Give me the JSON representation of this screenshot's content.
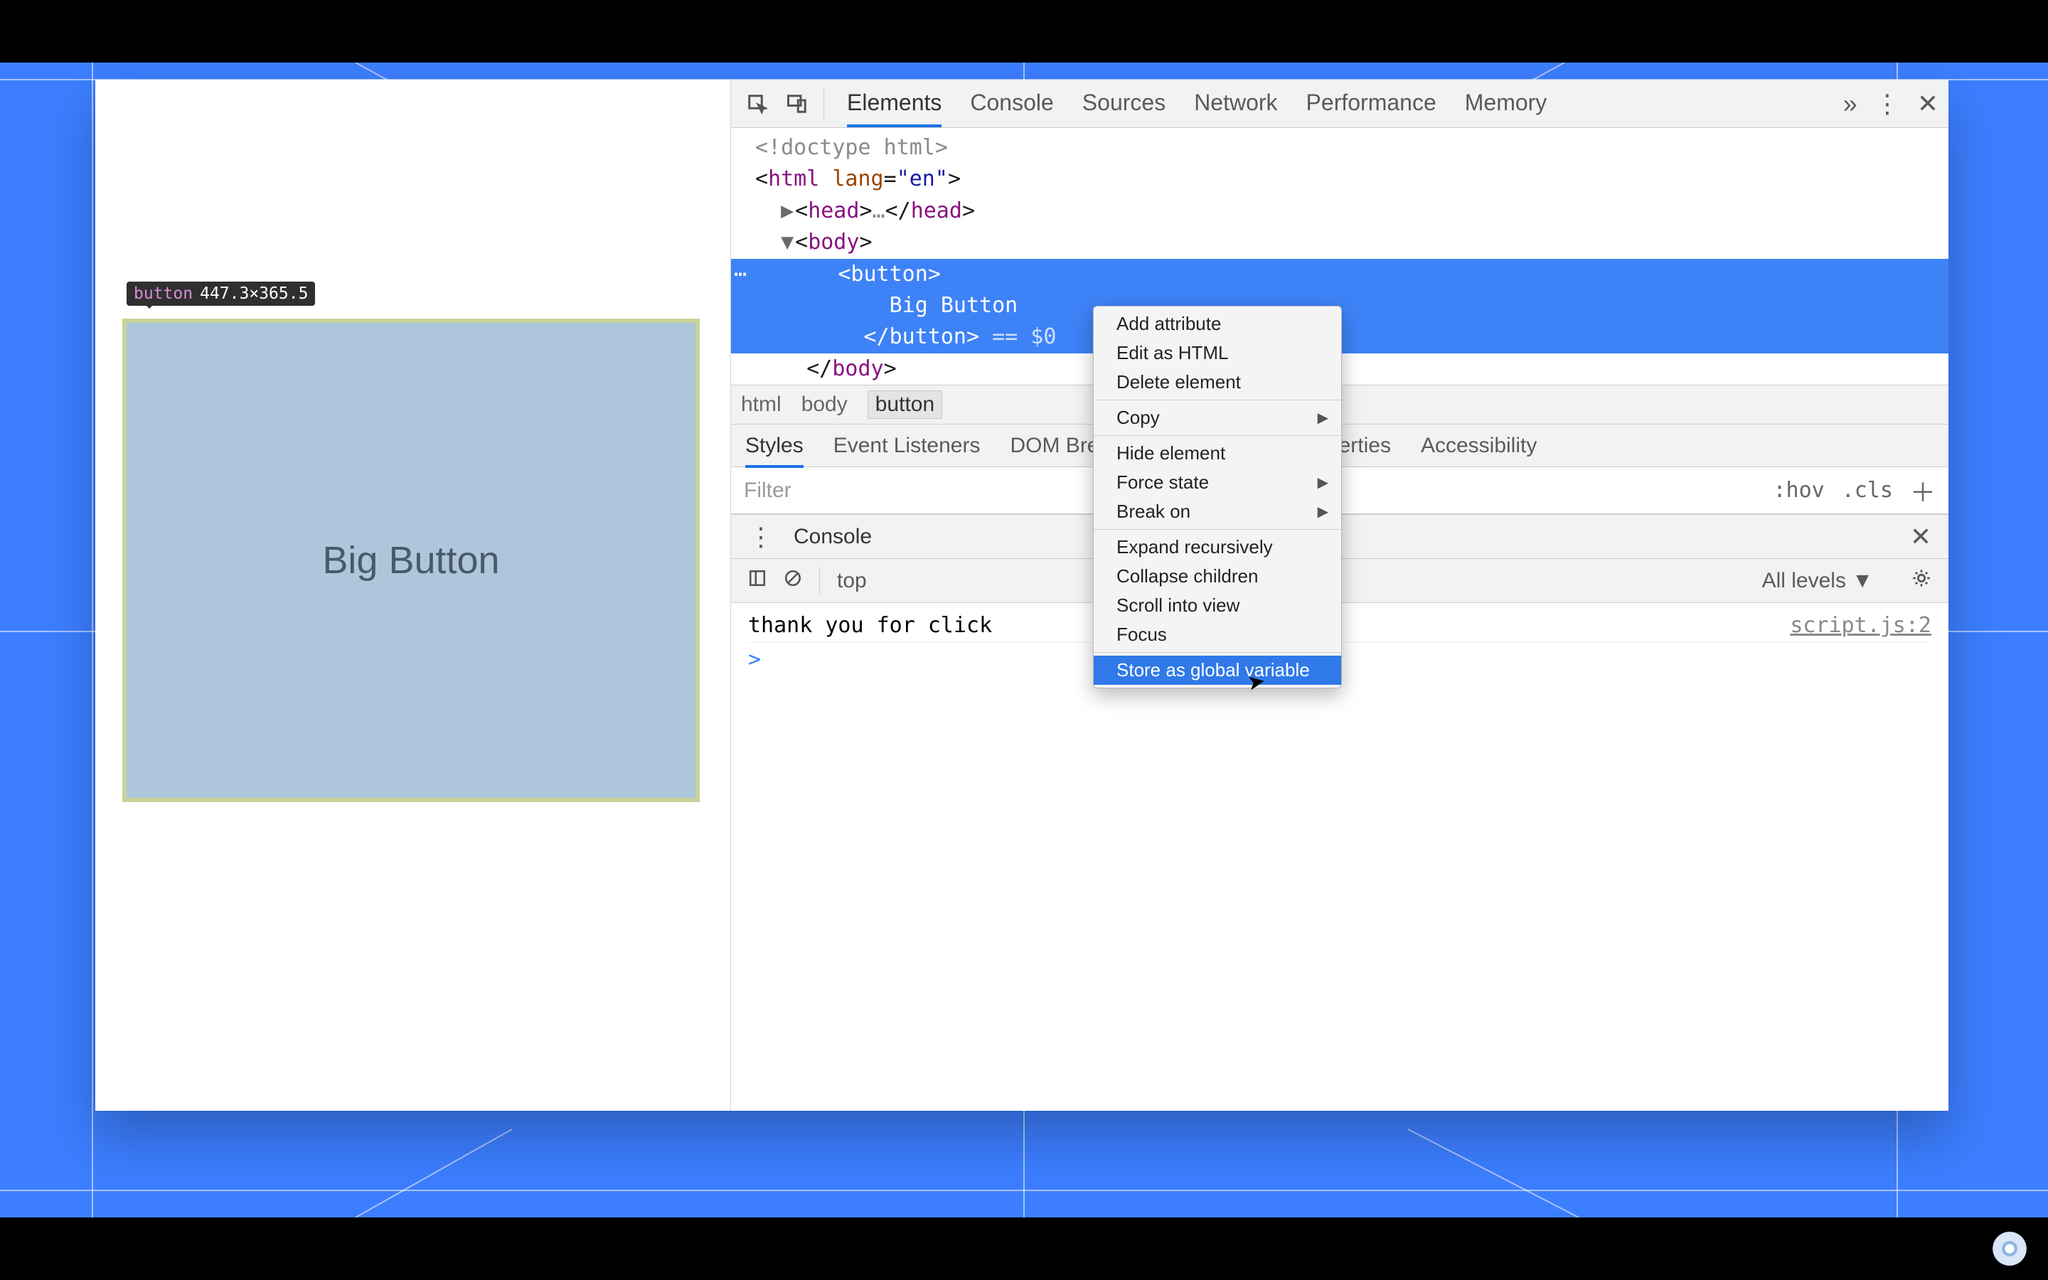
{
  "tooltip": {
    "tag": "button",
    "dims": "447.3×365.5"
  },
  "page": {
    "button_label": "Big Button"
  },
  "devtools": {
    "tabs": [
      "Elements",
      "Console",
      "Sources",
      "Network",
      "Performance",
      "Memory"
    ],
    "active_tab": "Elements",
    "dom": {
      "doctype": "<!doctype html>",
      "html_open": "<html lang=\"en\">",
      "head_collapsed_open": "<head>",
      "head_ellipsis": "…",
      "head_close": "</head>",
      "body_open": "<body>",
      "sel_open": "<button>",
      "sel_text": "Big Button",
      "sel_close": "</button>",
      "eq_dollar": "== $0",
      "body_close": "</body>"
    },
    "breadcrumbs": [
      "html",
      "body",
      "button"
    ],
    "subtabs": [
      "Styles",
      "Event Listeners",
      "DOM Breakpoints",
      "Properties",
      "Accessibility"
    ],
    "filter_placeholder": "Filter",
    "hov": ":hov",
    "cls": ".cls",
    "console_drawer_tab": "Console",
    "console_scope": "top",
    "console_level": "All levels ▼",
    "console_msg": "thank you for click",
    "console_src": "script.js:2",
    "prompt": ">"
  },
  "context_menu": {
    "items": [
      {
        "label": "Add attribute"
      },
      {
        "label": "Edit as HTML"
      },
      {
        "label": "Delete element"
      },
      {
        "sep": true
      },
      {
        "label": "Copy",
        "sub": true
      },
      {
        "sep": true
      },
      {
        "label": "Hide element"
      },
      {
        "label": "Force state",
        "sub": true
      },
      {
        "label": "Break on",
        "sub": true
      },
      {
        "sep": true
      },
      {
        "label": "Expand recursively"
      },
      {
        "label": "Collapse children"
      },
      {
        "label": "Scroll into view"
      },
      {
        "label": "Focus"
      },
      {
        "sep": true
      },
      {
        "label": "Store as global variable",
        "hover": true
      }
    ]
  }
}
